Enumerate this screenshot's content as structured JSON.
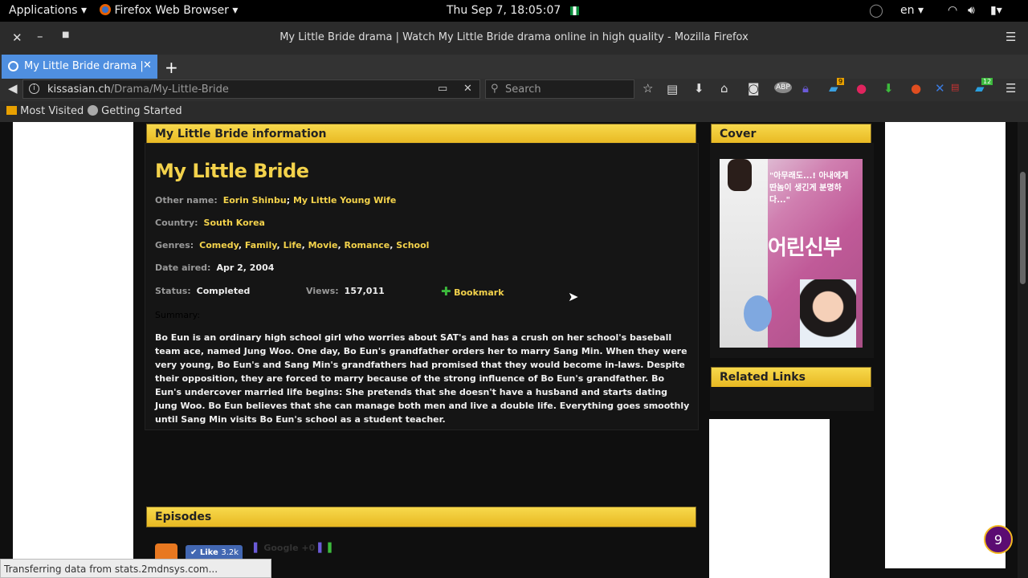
{
  "system": {
    "applications_label": "Applications",
    "browser_label": "Firefox Web Browser",
    "clock": "Thu Sep  7, 18:05:07",
    "lang": "en"
  },
  "window": {
    "title": "My Little Bride drama | Watch My Little Bride drama online in high quality - Mozilla Firefox"
  },
  "tabs": [
    {
      "label": "My Little Bride drama |"
    }
  ],
  "nav": {
    "url_host": "kissasian.ch",
    "url_path": "/Drama/My-Little-Bride",
    "search_placeholder": "Search",
    "badge_9": "9",
    "badge_12": "12"
  },
  "bookmarks": {
    "most_visited": "Most Visited",
    "getting_started": "Getting Started"
  },
  "info": {
    "header": "My Little Bride information",
    "title": "My Little Bride",
    "other_name_label": "Other name:",
    "other_names": [
      "Eorin Shinbu",
      "My Little Young Wife"
    ],
    "country_label": "Country:",
    "country": "South Korea",
    "genres_label": "Genres:",
    "genres": [
      "Comedy",
      "Family",
      "Life",
      "Movie",
      "Romance",
      "School"
    ],
    "date_label": "Date aired:",
    "date": "Apr 2, 2004",
    "status_label": "Status:",
    "status": "Completed",
    "views_label": "Views:",
    "views": "157,011",
    "bookmark_label": "Bookmark",
    "summary_label": "Summary:",
    "summary": "Bo Eun is an ordinary high school girl who worries about SAT's and has a crush on her school's baseball team ace, named Jung Woo. One day, Bo Eun's grandfather orders her to marry Sang Min. When they were very young, Bo Eun's and Sang Min's grandfathers had promised that they would become in-laws. Despite their opposition, they are forced to marry because of the strong influence of Bo Eun's grandfather. Bo Eun's undercover married life begins: She pretends that she doesn't have a husband and starts dating Jung Woo. Bo Eun believes that she can manage both men and live a double life. Everything goes smoothly until Sang Min visits Bo Eun's school as a student teacher."
  },
  "cover": {
    "header": "Cover",
    "poster_title": "어린신부",
    "poster_tagline": "\"아무래도...! 아내에게 딴놈이 생긴게 분명하다...\""
  },
  "related": {
    "header": "Related Links"
  },
  "episodes": {
    "header": "Episodes",
    "like_label": "Like",
    "like_count": "3.2k",
    "gplus": "Google +0"
  },
  "statusbar": "Transferring data from stats.2mdnsys.com...",
  "notification_count": "9"
}
